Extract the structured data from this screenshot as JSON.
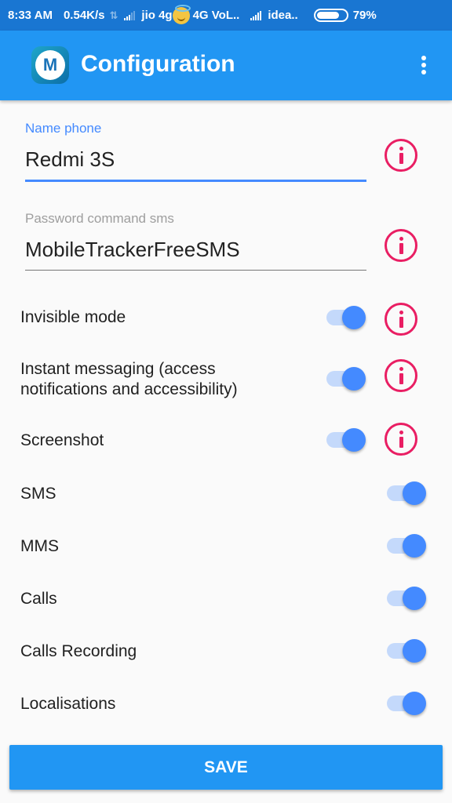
{
  "status_bar": {
    "time": "8:33 AM",
    "network_speed": "0.54K/s",
    "carrier1": "jio 4g",
    "network_type": "4G VoL..",
    "carrier2": "idea..",
    "battery_percent": "79%",
    "battery_level": 0.79
  },
  "app_bar": {
    "logo_letter": "M",
    "title": "Configuration",
    "menu_icon": "more-vert-icon"
  },
  "fields": [
    {
      "label": "Name phone",
      "value": "Redmi 3S",
      "focused": true
    },
    {
      "label": "Password command sms",
      "value": "MobileTrackerFreeSMS",
      "focused": false
    }
  ],
  "settings": [
    {
      "label": "Invisible mode",
      "enabled": true,
      "has_info": true
    },
    {
      "label": "Instant messaging (access notifications and accessibility)",
      "enabled": true,
      "has_info": true
    },
    {
      "label": "Screenshot",
      "enabled": true,
      "has_info": true
    },
    {
      "label": "SMS",
      "enabled": true,
      "has_info": false
    },
    {
      "label": "MMS",
      "enabled": true,
      "has_info": false
    },
    {
      "label": "Calls",
      "enabled": true,
      "has_info": false
    },
    {
      "label": "Calls Recording",
      "enabled": true,
      "has_info": false
    },
    {
      "label": "Localisations",
      "enabled": true,
      "has_info": false
    }
  ],
  "save_button": {
    "label": "SAVE"
  },
  "colors": {
    "status_bar": "#1976d2",
    "app_bar": "#2196f3",
    "accent": "#448aff",
    "info": "#e91e63",
    "background": "#fafafa"
  }
}
